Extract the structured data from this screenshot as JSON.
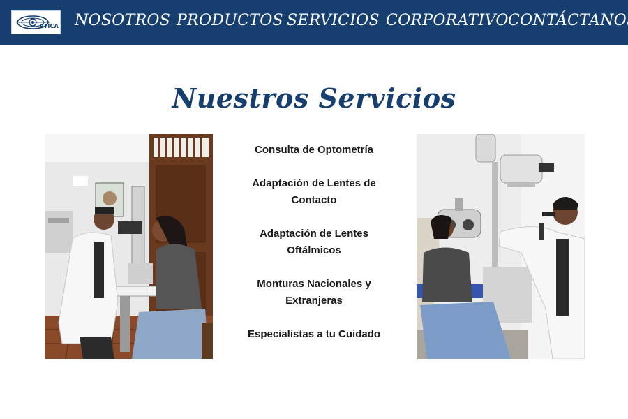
{
  "nav": {
    "logo_text": "PTICA",
    "items": [
      "NOSOTROS",
      "PRODUCTOS",
      "SERVICIOS",
      "CORPORATIVO",
      "CONTÁCTANOS"
    ]
  },
  "section_title": "Nuestros Servicios",
  "services": [
    "Consulta de Optometría",
    "Adaptación de Lentes de Contacto",
    "Adaptación de Lentes Oftálmicos",
    "Monturas Nacionales y Extranjeras",
    "Especialistas a tu Cuidado"
  ],
  "colors": {
    "nav_background": "#163e6e",
    "title_color": "#163e6e",
    "text_color": "#1a1a1a",
    "background": "#ffffff"
  },
  "images": {
    "left": "photo-optometrist-slit-lamp-exam",
    "right": "photo-optometrist-phoropter-exam"
  }
}
